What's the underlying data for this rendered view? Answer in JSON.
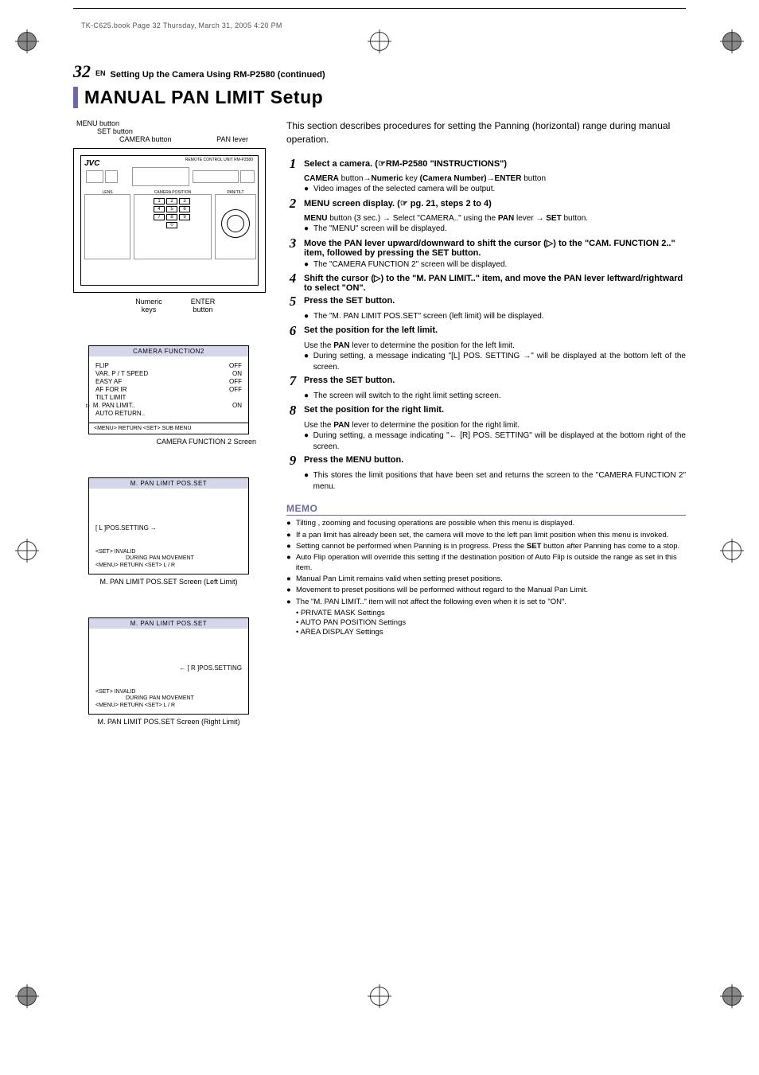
{
  "meta": {
    "book_label": "TK-C625.book  Page 32  Thursday, March 31, 2005  4:20 PM"
  },
  "header": {
    "page_num": "32",
    "lang": "EN",
    "running": "Setting Up the Camera Using RM-P2580 (continued)",
    "h1": "MANUAL PAN LIMIT Setup"
  },
  "diagram": {
    "menu_btn": "MENU button",
    "set_btn": "SET button",
    "camera_btn": "CAMERA button",
    "pan_lever": "PAN lever",
    "numeric": "Numeric keys",
    "enter": "ENTER button",
    "remote_label": "REMOTE CONTROL UNIT RM-P2580",
    "section_lens": "LENS",
    "section_campos": "CAMERA POSITION",
    "section_pantilt": "PAN/TILT"
  },
  "osd1": {
    "title": "CAMERA  FUNCTION2",
    "rows": [
      {
        "l": "FLIP",
        "r": "OFF"
      },
      {
        "l": "VAR. P / T  SPEED",
        "r": "ON"
      },
      {
        "l": "EASY  AF",
        "r": "OFF"
      },
      {
        "l": "AF  FOR  IR",
        "r": "OFF"
      },
      {
        "l": "TILT  LIMIT",
        "r": ""
      },
      {
        "l": "M. PAN  LIMIT..",
        "r": "ON"
      },
      {
        "l": "AUTO  RETURN..",
        "r": ""
      }
    ],
    "foot": "<MENU> RETURN  <SET> SUB  MENU",
    "caption": "CAMERA FUNCTION 2 Screen"
  },
  "osd2": {
    "title": "M. PAN  LIMIT POS.SET",
    "line1": "[ L ]POS.SETTING  →",
    "foot1": "<SET> INVALID",
    "foot2": "DURING  PAN  MOVEMENT",
    "foot3": "<MENU> RETURN  <SET> L / R",
    "caption": "M. PAN LIMIT POS.SET Screen (Left Limit)"
  },
  "osd3": {
    "title": "M. PAN  LIMIT POS.SET",
    "line1": "←  [ R ]POS.SETTING",
    "foot1": "<SET> INVALID",
    "foot2": "DURING  PAN  MOVEMENT",
    "foot3": "<MENU> RETURN  <SET> L / R",
    "caption": "M. PAN LIMIT POS.SET Screen (Right Limit)"
  },
  "intro": "This section describes procedures for setting the Panning (horizontal) range during manual operation.",
  "steps": {
    "s1": {
      "title_a": "Select a camera. (☞",
      "title_b": "RM-P2580",
      "title_c": " \"",
      "title_d": "INSTRUCTIONS",
      "title_e": "\")",
      "line": "CAMERA button→Numeric key (Camera Number)→ENTER button",
      "bul": "Video images of the selected camera will be output."
    },
    "s2": {
      "title": "MENU screen display. (☞ pg. 21, steps 2 to 4)",
      "line_a": "MENU",
      "line_b": " button (3 sec.) → Select \"CAMERA..\" using the ",
      "line_c": "PAN",
      "line_d": " lever → ",
      "line_e": "SET",
      "line_f": " button.",
      "bul": "The \"MENU\" screen will be displayed."
    },
    "s3": {
      "title": "Move the PAN lever upward/downward to shift the cursor (▷) to the \"CAM. FUNCTION 2..\" item, followed by pressing the SET button.",
      "bul": "The \"CAMERA FUNCTION 2\" screen will be displayed."
    },
    "s4": {
      "title": "Shift the cursor (▷) to the \"M. PAN LIMIT..\" item, and move the PAN lever leftward/rightward to select \"ON\"."
    },
    "s5": {
      "title": "Press the SET button.",
      "bul": "The \"M. PAN LIMIT POS.SET\" screen (left limit) will be displayed."
    },
    "s6": {
      "title": "Set the position for the left limit.",
      "line_a": "Use the ",
      "line_b": "PAN",
      "line_c": " lever to determine the position for the left limit.",
      "bul": "During setting, a message indicating \"[L] POS. SETTING →\" will be displayed at the bottom left of the screen."
    },
    "s7": {
      "title": "Press the SET button.",
      "bul": "The screen will switch to the right limit setting screen."
    },
    "s8": {
      "title": "Set the position for the right limit.",
      "line_a": "Use the ",
      "line_b": "PAN",
      "line_c": " lever to determine the position for the right limit.",
      "bul": "During setting, a message indicating \"← [R] POS. SETTING\" will be displayed at the bottom right of the screen."
    },
    "s9": {
      "title": "Press the MENU button.",
      "bul": "This stores the limit positions that have been set and returns the screen to the \"CAMERA FUNCTION 2\" menu."
    }
  },
  "memo": {
    "heading": "MEMO",
    "items": [
      "Tilting , zooming and focusing operations are possible when this menu is displayed.",
      "If a pan limit has already been set, the camera will move to the left pan limit position when this menu is invoked.",
      "Setting cannot be performed when Panning is in progress. Press the SET button after Panning has come to a stop.",
      "Auto Flip operation will override this setting if the destination position of Auto Flip is outside the range as set in this item.",
      "Manual Pan Limit remains valid when setting preset positions.",
      "Movement to preset positions will be performed without regard to the Manual Pan Limit.",
      "The \"M. PAN LIMIT..\" item will not affect the following even when it is set to \"ON\"."
    ],
    "nested": [
      "• PRIVATE MASK Settings",
      "• AUTO PAN POSITION Settings",
      "• AREA DISPLAY Settings"
    ],
    "set_bold": "SET"
  }
}
